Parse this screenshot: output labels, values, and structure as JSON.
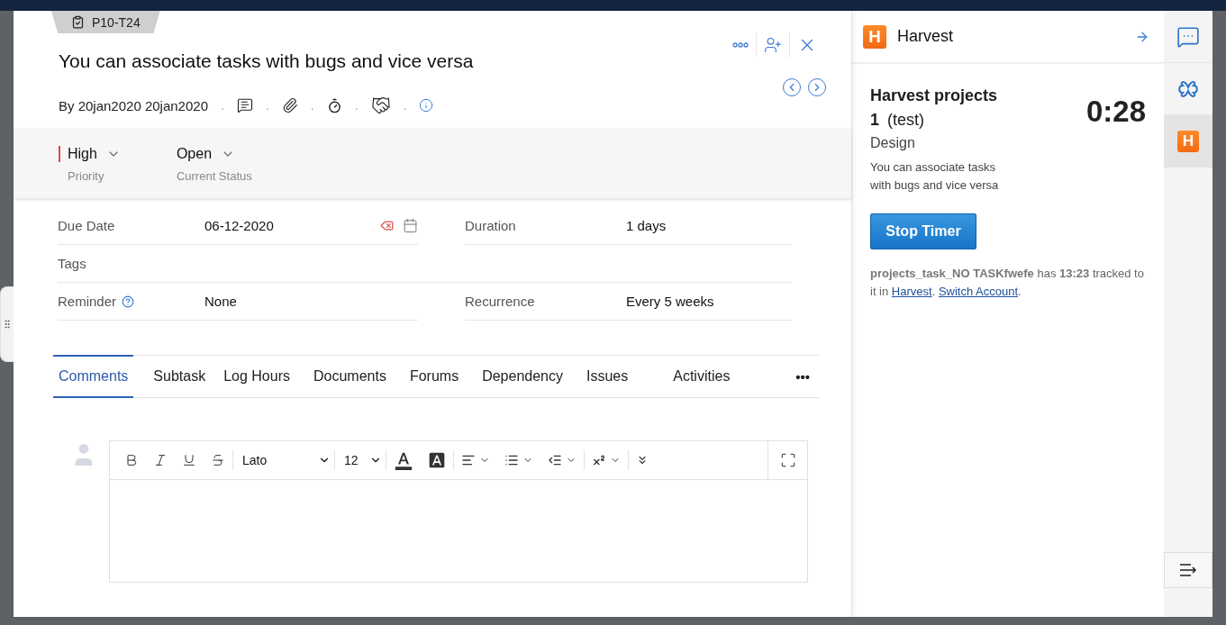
{
  "task_id": "P10-T24",
  "title": "You can associate tasks with bugs and vice versa",
  "byline": "By 20jan2020 20jan2020",
  "meta_separator": ".",
  "priority": {
    "value": "High",
    "label": "Priority",
    "color": "#e5484d"
  },
  "status": {
    "value": "Open",
    "label": "Current Status"
  },
  "fields": [
    {
      "kind": "date",
      "label": "Due Date",
      "value": "06-12-2020"
    },
    {
      "kind": "text",
      "label": "Duration",
      "value": "1 days"
    },
    {
      "kind": "wide",
      "label": "Tags"
    },
    {
      "kind": "help",
      "label": "Reminder",
      "value": "None"
    },
    {
      "kind": "text",
      "label": "Recurrence",
      "value": "Every 5 weeks"
    }
  ],
  "tabs": [
    {
      "label": "Comments",
      "selected": true
    },
    {
      "label": "Subtask",
      "selected": false
    },
    {
      "label": "Log Hours",
      "selected": false
    },
    {
      "label": "Documents",
      "selected": false
    },
    {
      "label": "Forums",
      "selected": false
    },
    {
      "label": "Dependency",
      "selected": false
    },
    {
      "label": "Issues",
      "selected": false
    },
    {
      "label": "Activities",
      "selected": false
    }
  ],
  "more_tabs": "•••",
  "editor": {
    "font": "Lato",
    "size": "12"
  },
  "harvest": {
    "logo_letter": "H",
    "title": "Harvest",
    "project": "Harvest projects 1",
    "client": "(test)",
    "task": "Design",
    "notes": "You can associate tasks with bugs and vice versa",
    "timer": "0:28",
    "button": "Stop Timer",
    "summary": [
      {
        "kind": "text",
        "text": "**projects_task_NO TASKfwefe** has **13:23** tracked to it in "
      },
      {
        "kind": "link",
        "text": "Harvest"
      },
      {
        "kind": "text",
        "text": ". "
      },
      {
        "kind": "link",
        "text": "Switch Account"
      },
      {
        "kind": "text",
        "text": "."
      }
    ]
  },
  "rail": [
    {
      "kind": "chat",
      "selected": false
    },
    {
      "kind": "clover",
      "selected": false
    },
    {
      "kind": "harvest",
      "letter": "H",
      "selected": true
    }
  ]
}
